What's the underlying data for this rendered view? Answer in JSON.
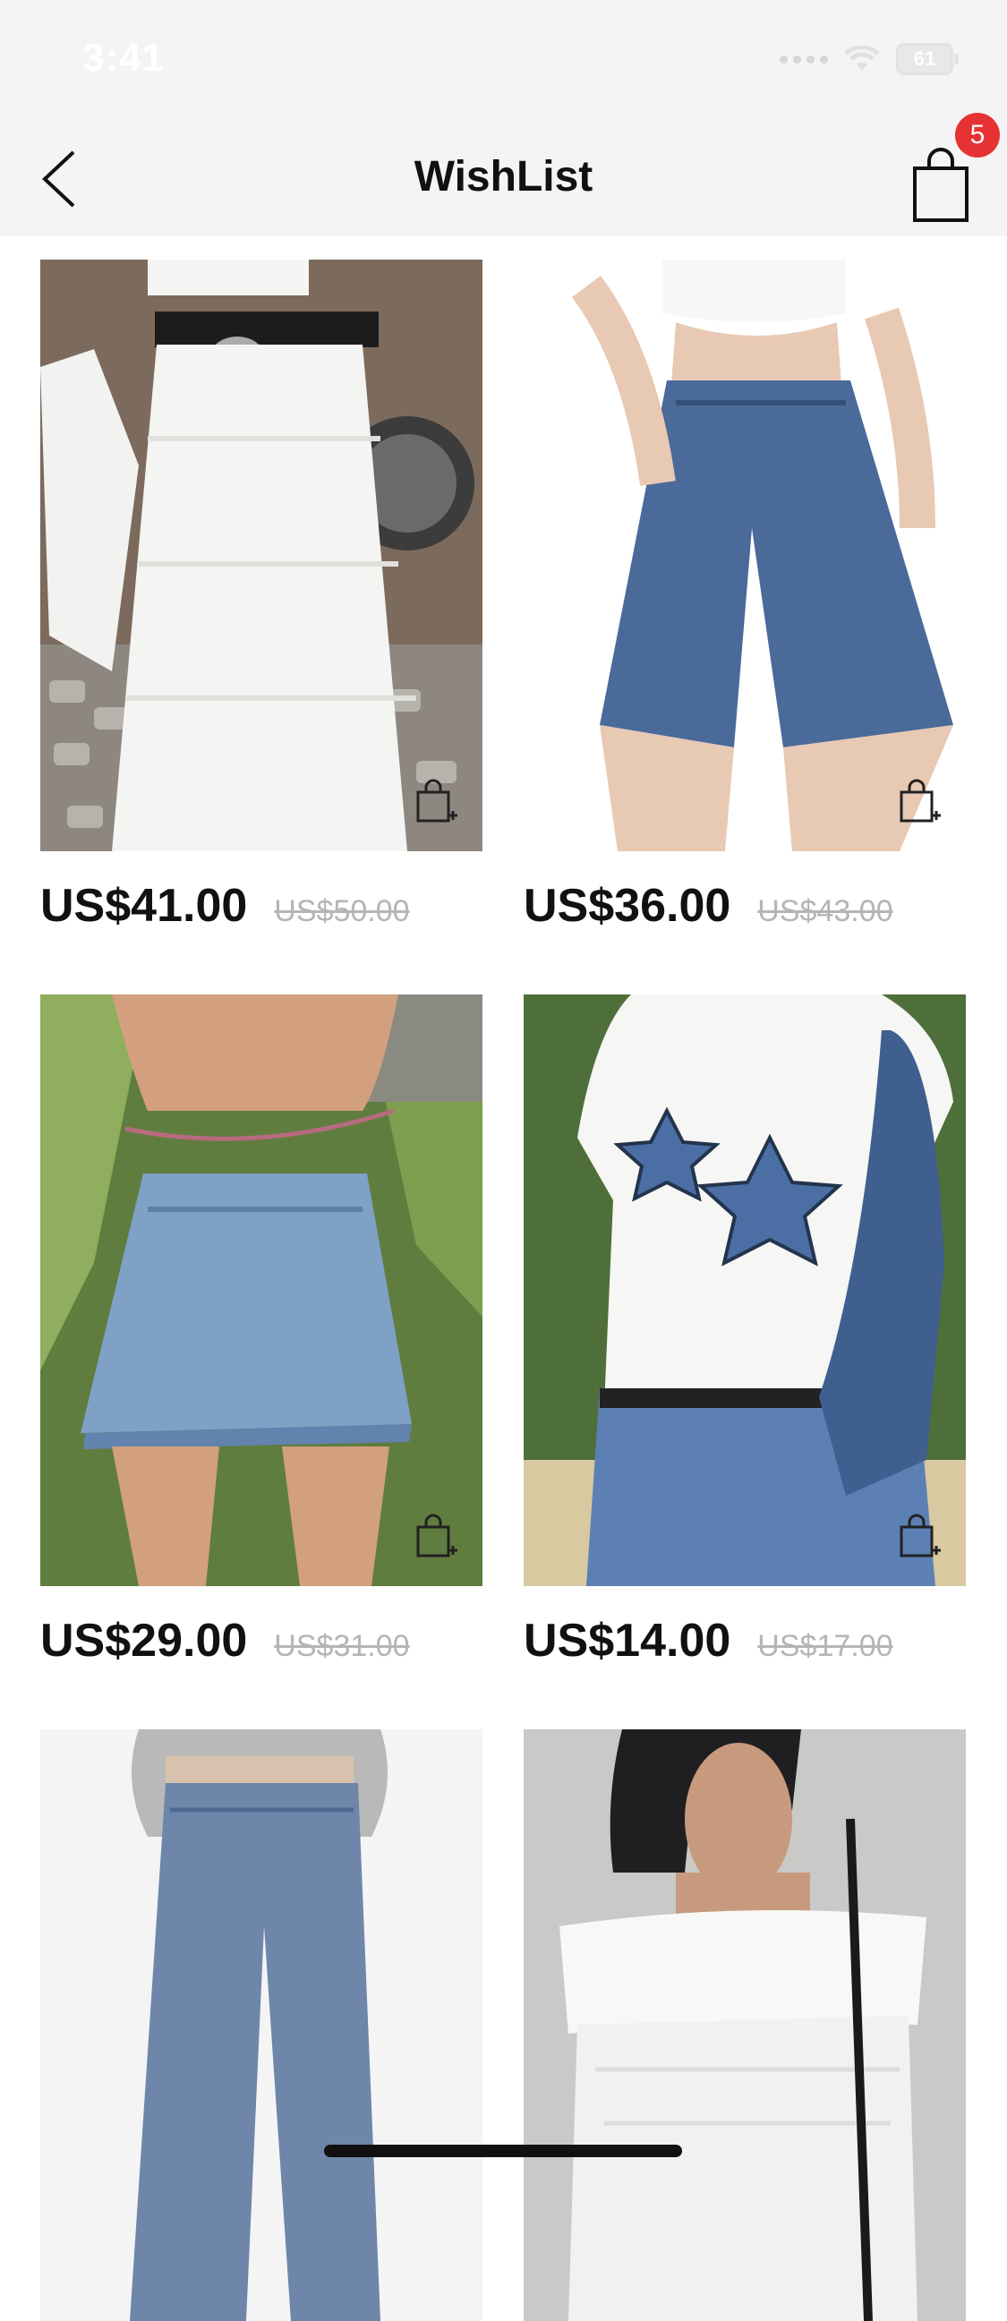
{
  "status_bar": {
    "time": "3:41",
    "battery": "61"
  },
  "nav": {
    "title": "WishList",
    "cart_count": "5"
  },
  "products": [
    {
      "price": "US$41.00",
      "old_price": "US$50.00",
      "image": "white tiered maxi skirt with black belt"
    },
    {
      "price": "US$36.00",
      "old_price": "US$43.00",
      "image": "denim bermuda shorts"
    },
    {
      "price": "US$29.00",
      "old_price": "US$31.00",
      "image": "denim mini skirt"
    },
    {
      "price": "US$14.00",
      "old_price": "US$17.00",
      "image": "white star graphic tee"
    },
    {
      "price": "",
      "old_price": "",
      "image": "wide leg jeans"
    },
    {
      "price": "",
      "old_price": "",
      "image": "white off-shoulder top"
    }
  ],
  "colors": {
    "accent_badge": "#e63232",
    "header_bg": "#f4f4f4",
    "old_price": "#b5b5b5"
  },
  "icons": {
    "back": "chevron-left-icon",
    "cart": "shopping-bag-icon",
    "add_to_cart": "bag-plus-icon"
  }
}
